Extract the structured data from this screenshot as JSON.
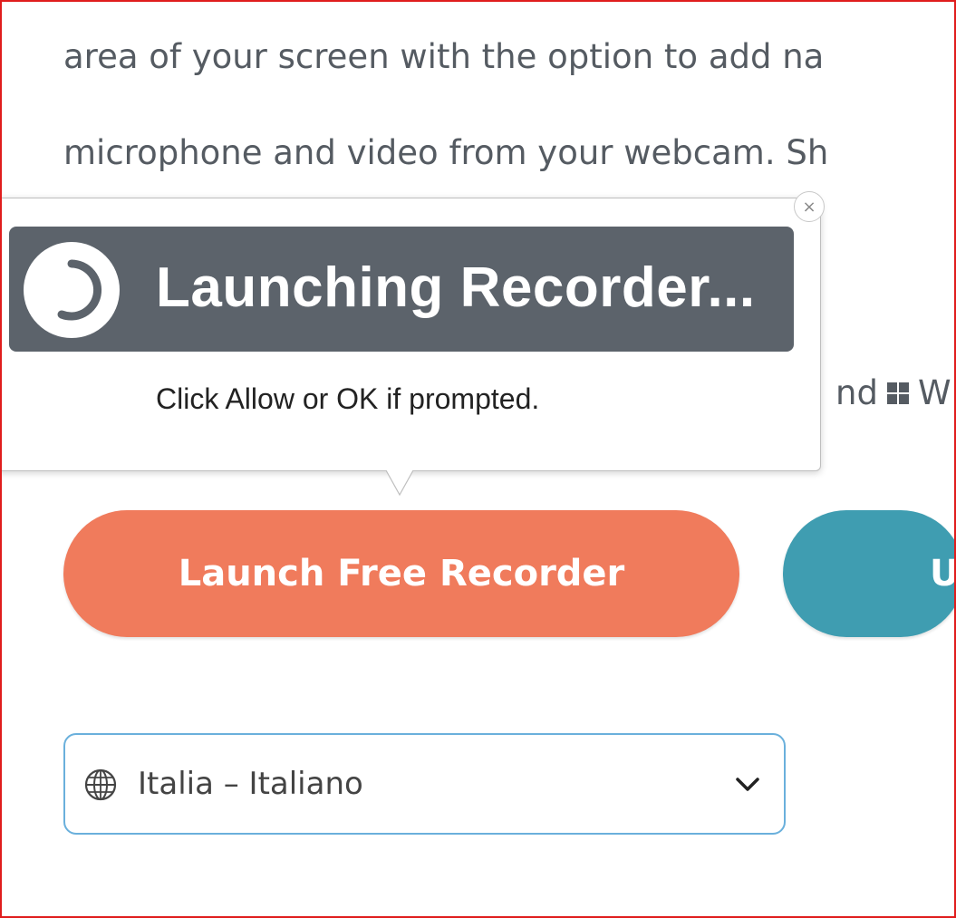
{
  "page": {
    "line1": "area of your screen with the option to add na",
    "line2": "microphone and video from your webcam. Sh",
    "line3_prefix": "nd",
    "line3_suffix": "W"
  },
  "popup": {
    "title": "Launching Recorder...",
    "hint": "Click Allow or OK if prompted.",
    "close_glyph": "×"
  },
  "buttons": {
    "launch_label": "Launch Free Recorder",
    "second_label": "U"
  },
  "language_select": {
    "value": "Italia – Italiano"
  },
  "colors": {
    "launch_button": "#f07b5c",
    "second_button": "#3f9db1",
    "banner": "#5c636b",
    "select_border": "#6ab0dc",
    "frame": "#e01d1d"
  },
  "icons": {
    "spinner": "spinner-icon",
    "close": "close-icon",
    "windows": "windows-icon",
    "globe": "globe-icon",
    "chevron": "chevron-down-icon"
  }
}
